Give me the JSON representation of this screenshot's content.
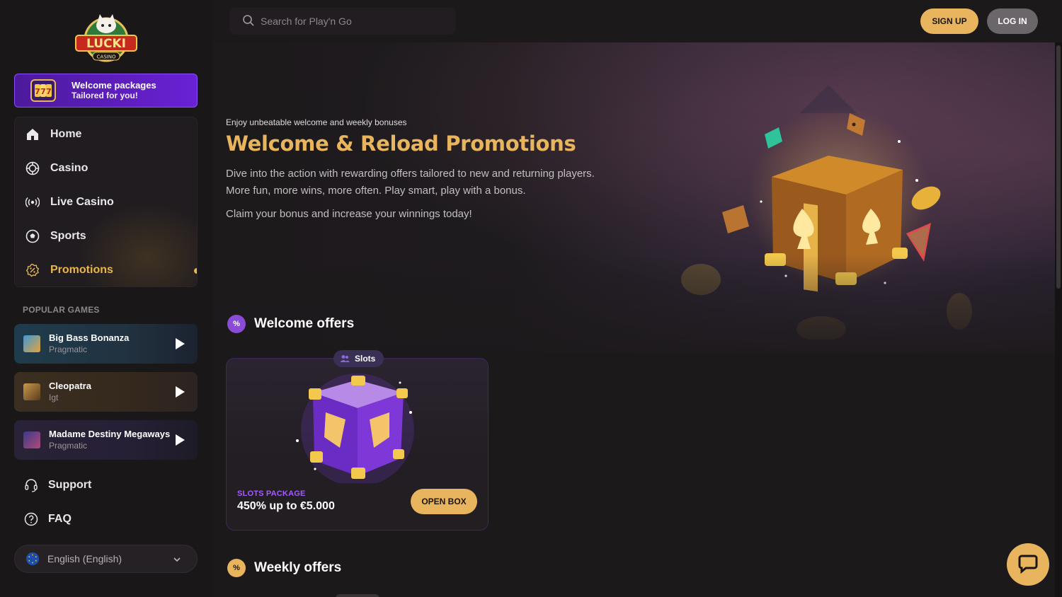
{
  "brand": {
    "logo_text": "LUCKI",
    "logo_sub": "CASINO"
  },
  "sidebar": {
    "welcome": {
      "line1": "Welcome packages",
      "line2": "Tailored for you!"
    },
    "nav": [
      {
        "label": "Home",
        "icon": "home-icon"
      },
      {
        "label": "Casino",
        "icon": "casino-chip-icon"
      },
      {
        "label": "Live Casino",
        "icon": "live-broadcast-icon"
      },
      {
        "label": "Sports",
        "icon": "soccer-ball-icon"
      },
      {
        "label": "Promotions",
        "icon": "promotion-badge-icon",
        "active": true
      }
    ],
    "popular_label": "POPULAR GAMES",
    "games": [
      {
        "name": "Big Bass Bonanza",
        "provider": "Pragmatic"
      },
      {
        "name": "Cleopatra",
        "provider": "Igt"
      },
      {
        "name": "Madame Destiny Megaways",
        "provider": "Pragmatic"
      }
    ],
    "support": "Support",
    "faq": "FAQ",
    "language": "English (English)"
  },
  "header": {
    "search_placeholder": "Search for Play'n Go",
    "signup": "SIGN UP",
    "login": "LOG IN"
  },
  "hero": {
    "kicker": "Enjoy unbeatable welcome and weekly bonuses",
    "title": "Welcome & Reload Promotions",
    "desc_line1": "Dive into the action with rewarding offers tailored to new and returning players.",
    "desc_line2": "More fun, more wins, more often. Play smart, play with a bonus.",
    "claim": "Claim your bonus and increase your winnings today!"
  },
  "welcome_offers": {
    "heading": "Welcome offers",
    "badge": "%",
    "card": {
      "tag": "Slots",
      "kicker": "SLOTS PACKAGE",
      "title": "450% up to €5.000",
      "button": "OPEN BOX"
    }
  },
  "weekly_offers": {
    "heading": "Weekly offers",
    "badge": "%"
  },
  "colors": {
    "accent_gold": "#e8b55e",
    "accent_purple": "#a35bff",
    "background": "#1c191b"
  }
}
